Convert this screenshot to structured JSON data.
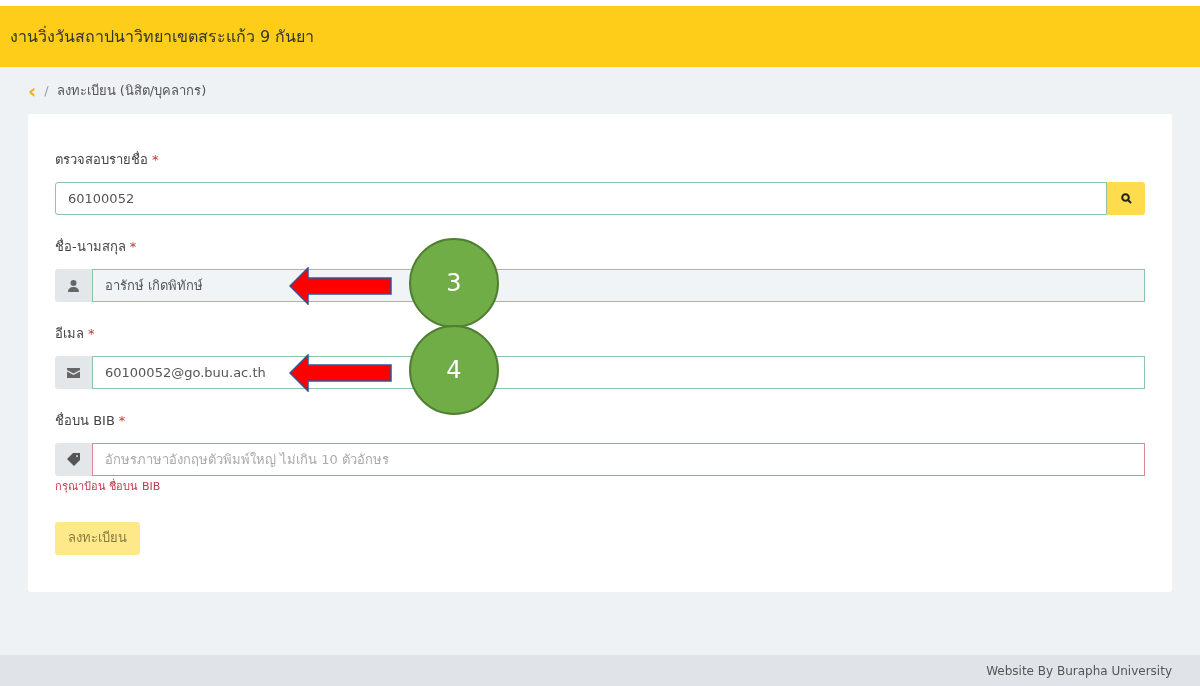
{
  "header": {
    "title": "งานวิ่งวันสถาปนาวิทยาเขตสระแก้ว 9 กันยา"
  },
  "breadcrumb": {
    "back": "‹",
    "separator": "/",
    "current": "ลงทะเบียน (นิสิต/บุคลากร)"
  },
  "fields": [
    {
      "kind": "search",
      "label": "ตรวจสอบรายชื่อ",
      "required_mark": "*",
      "value": "60100052",
      "readonly": false,
      "invalid": false
    },
    {
      "kind": "person",
      "label": "ชื่อ-นามสกุล",
      "required_mark": "*",
      "value": "อารักษ์ เกิดพิทักษ์",
      "readonly": true,
      "invalid": false,
      "callout": "3"
    },
    {
      "kind": "mail",
      "label": "อีเมล",
      "required_mark": "*",
      "value": "60100052@go.buu.ac.th",
      "readonly": false,
      "invalid": false,
      "callout": "4"
    },
    {
      "kind": "tag",
      "label": "ชื่อบน BIB",
      "required_mark": "*",
      "placeholder": "อักษรภาษาอังกฤษตัวพิมพ์ใหญ่ ไม่เกิน 10 ตัวอักษร",
      "readonly": false,
      "invalid": true,
      "error": "กรุณาป้อน ชื่อบน BIB"
    }
  ],
  "submit_button": {
    "label": "ลงทะเบียน",
    "disabled": true
  },
  "footer": {
    "text": "Website By Burapha University"
  }
}
